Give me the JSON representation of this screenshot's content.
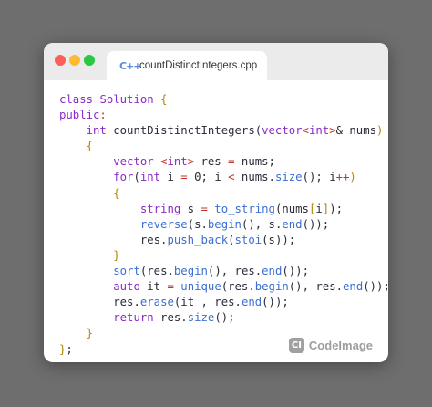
{
  "tab": {
    "icon_text": "C++",
    "filename": "countDistinctIntegers.cpp"
  },
  "code_lines": [
    [
      [
        "class",
        "kw"
      ],
      [
        " "
      ],
      [
        "Solution",
        "kw"
      ],
      [
        " "
      ],
      [
        "{",
        "br"
      ]
    ],
    [
      [
        "public",
        "kw"
      ],
      [
        ":",
        "op"
      ]
    ],
    [
      [
        "    "
      ],
      [
        "int",
        "kw"
      ],
      [
        " countDistinctIntegers("
      ],
      [
        "vector",
        "ty"
      ],
      [
        "<",
        "op"
      ],
      [
        "int",
        "kw"
      ],
      [
        ">",
        "op"
      ],
      [
        "& nums"
      ],
      [
        ")",
        "br"
      ]
    ],
    [
      [
        "    "
      ],
      [
        "{",
        "br"
      ]
    ],
    [
      [
        "        "
      ],
      [
        "vector",
        "ty"
      ],
      [
        " "
      ],
      [
        "<",
        "op"
      ],
      [
        "int",
        "kw"
      ],
      [
        ">",
        "op"
      ],
      [
        " res "
      ],
      [
        "=",
        "op"
      ],
      [
        " nums;"
      ]
    ],
    [
      [
        "        "
      ],
      [
        "for",
        "kw"
      ],
      [
        "("
      ],
      [
        "int",
        "kw"
      ],
      [
        " i "
      ],
      [
        "=",
        "op"
      ],
      [
        " 0; i "
      ],
      [
        "<",
        "op"
      ],
      [
        " nums."
      ],
      [
        "size",
        "fn"
      ],
      [
        "(); i"
      ],
      [
        "++",
        "op"
      ],
      [
        ")",
        "br"
      ]
    ],
    [
      [
        "        "
      ],
      [
        "{",
        "br"
      ]
    ],
    [
      [
        "            "
      ],
      [
        "string",
        "ty"
      ],
      [
        " s "
      ],
      [
        "=",
        "op"
      ],
      [
        " "
      ],
      [
        "to_string",
        "fn"
      ],
      [
        "(nums"
      ],
      [
        "[",
        "br"
      ],
      [
        "i"
      ],
      [
        "]",
        "br"
      ],
      [
        ");"
      ]
    ],
    [
      [
        "            "
      ],
      [
        "reverse",
        "fn"
      ],
      [
        "(s."
      ],
      [
        "begin",
        "fn"
      ],
      [
        "(), s."
      ],
      [
        "end",
        "fn"
      ],
      [
        "());"
      ]
    ],
    [
      [
        "            "
      ],
      [
        "res."
      ],
      [
        "push_back",
        "fn"
      ],
      [
        "("
      ],
      [
        "stoi",
        "fn"
      ],
      [
        "(s));"
      ]
    ],
    [
      [
        "        "
      ],
      [
        "}",
        "br"
      ]
    ],
    [
      [
        "        "
      ],
      [
        "sort",
        "fn"
      ],
      [
        "(res."
      ],
      [
        "begin",
        "fn"
      ],
      [
        "(), res."
      ],
      [
        "end",
        "fn"
      ],
      [
        "());"
      ]
    ],
    [
      [
        "        "
      ],
      [
        "auto",
        "kw"
      ],
      [
        " it "
      ],
      [
        "=",
        "op"
      ],
      [
        " "
      ],
      [
        "unique",
        "fn"
      ],
      [
        "(res."
      ],
      [
        "begin",
        "fn"
      ],
      [
        "(), res."
      ],
      [
        "end",
        "fn"
      ],
      [
        "());"
      ]
    ],
    [
      [
        "        "
      ],
      [
        "res."
      ],
      [
        "erase",
        "fn"
      ],
      [
        "(it , res."
      ],
      [
        "end",
        "fn"
      ],
      [
        "());"
      ]
    ],
    [
      [
        "        "
      ],
      [
        "return",
        "kw"
      ],
      [
        " res."
      ],
      [
        "size",
        "fn"
      ],
      [
        "();"
      ]
    ],
    [
      [
        "    "
      ],
      [
        "}",
        "br"
      ]
    ],
    [
      [
        "}",
        "br"
      ],
      [
        ";"
      ]
    ]
  ],
  "token_colors": {
    "kw": "#8a2bc9",
    "ty": "#8a2bc9",
    "fn": "#3c6fd0",
    "op": "#c0342b",
    "br": "#b08800",
    "plain": "#2c2c3a"
  },
  "brand": {
    "icon_text": "CI",
    "label": "CodeImage"
  }
}
